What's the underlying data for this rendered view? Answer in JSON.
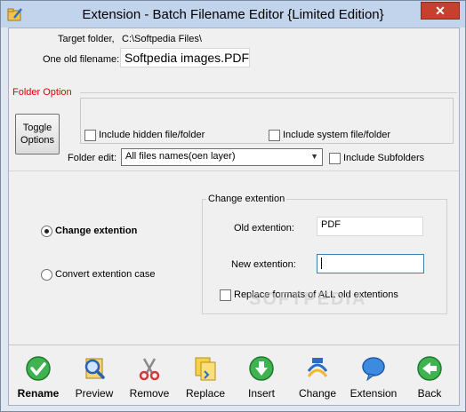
{
  "window": {
    "title": "Extension - Batch Filename Editor {Limited Edition}",
    "close_label": "✕"
  },
  "target_folder": {
    "label": "Target folder,",
    "value": "C:\\Softpedia Files\\"
  },
  "old_filename": {
    "label": "One old filename:",
    "value": "Softpedia images.PDF"
  },
  "folder_option": {
    "title": "Folder Option",
    "toggle_button": "Toggle Options",
    "include_hidden": {
      "label": "Include hidden file/folder",
      "checked": false
    },
    "include_system": {
      "label": "Include system file/folder",
      "checked": false
    },
    "folder_edit_label": "Folder edit:",
    "folder_edit_value": "All files names(oen layer)",
    "include_subfolders": {
      "label": "Include Subfolders",
      "checked": false
    }
  },
  "mode": {
    "change_extention": {
      "label": "Change extention",
      "selected": true
    },
    "convert_case": {
      "label": "Convert extention case",
      "selected": false
    }
  },
  "change_extention_group": {
    "title": "Change extention",
    "old_label": "Old extention:",
    "old_value": "PDF",
    "new_label": "New extention:",
    "new_value": "",
    "replace_all": {
      "label": "Replace formats of ALL old extentions",
      "checked": false
    }
  },
  "watermark": "SOFTPEDIA",
  "toolbar": {
    "rename": "Rename",
    "preview": "Preview",
    "remove": "Remove",
    "replace": "Replace",
    "insert": "Insert",
    "change": "Change",
    "extension": "Extension",
    "back": "Back"
  },
  "icons": {
    "app": "folder-pencil-icon",
    "rename": "green-check-icon",
    "preview": "magnifier-icon",
    "remove": "scissors-icon",
    "replace": "yellow-docs-icon",
    "insert": "green-down-arrow-icon",
    "change": "blue-swirl-icon",
    "extension": "blue-speech-bubble-icon",
    "back": "green-left-arrow-icon"
  }
}
